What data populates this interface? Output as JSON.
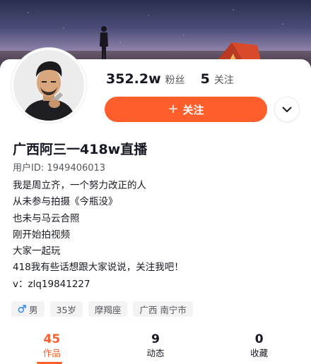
{
  "profile": {
    "nickname": "广西阿三一418w直播",
    "user_id": "用户ID: 1949406013",
    "bio": [
      "我是周立齐，一个努力改正的人",
      "从未参与拍摄《今瓶没》",
      "也未与马云合照",
      "刚开始拍视频",
      "大家一起玩",
      "418我有些话想跟大家说说，关注我吧！",
      "v：zlq19841227"
    ]
  },
  "stats": {
    "fans_count": "352.2w",
    "fans_label": "粉丝",
    "following_count": "5",
    "following_label": "关注"
  },
  "actions": {
    "follow_icon": "+",
    "follow_label": "关注",
    "more_icon": "chevron-down-icon"
  },
  "tags": [
    {
      "icon": "male-icon",
      "label": "男"
    },
    {
      "label": "35岁"
    },
    {
      "label": "摩羯座"
    },
    {
      "label": "广西 南宁市"
    }
  ],
  "tabs": [
    {
      "count": "45",
      "label": "作品",
      "active": true
    },
    {
      "count": "9",
      "label": "动态",
      "active": false
    },
    {
      "count": "0",
      "label": "收藏",
      "active": false
    }
  ],
  "colors": {
    "accent": "#fe5e2c",
    "male_icon": "#3a8bf0",
    "text_primary": "#161823",
    "text_secondary": "#55575f"
  }
}
